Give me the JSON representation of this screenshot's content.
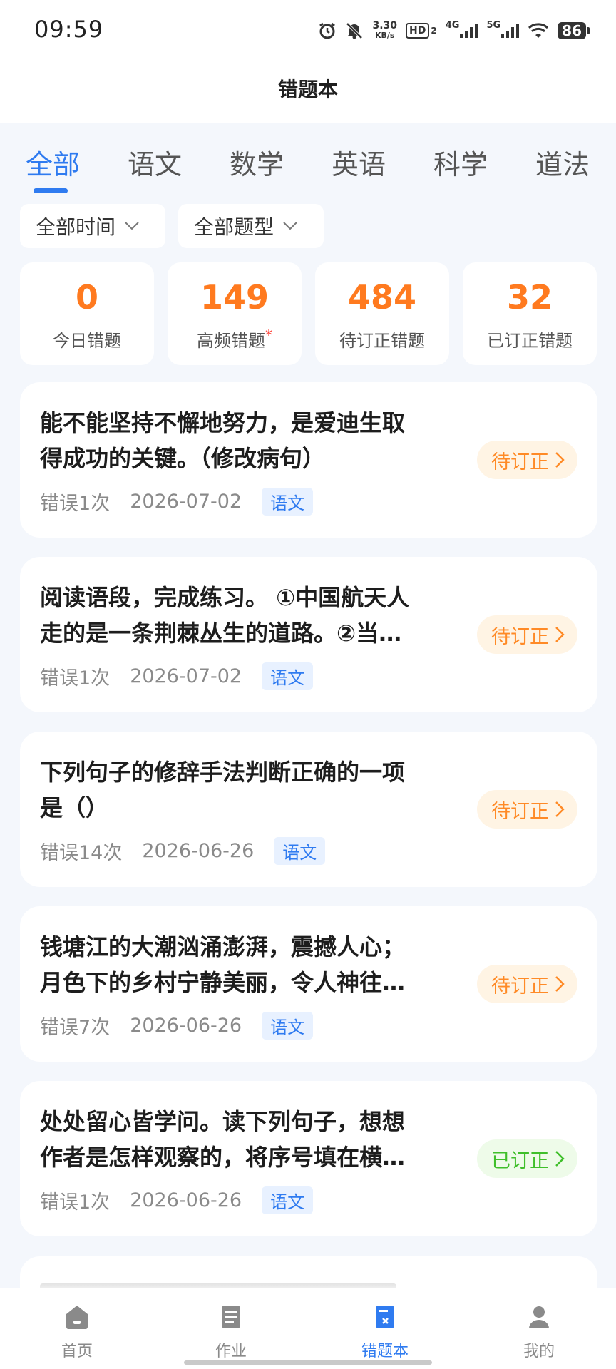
{
  "statusbar": {
    "time": "09:59",
    "speed_top": "3.30",
    "speed_bottom": "KB/s",
    "hd": "HD",
    "hd_sub": "2",
    "net1": "4G",
    "net2": "5G",
    "battery": "86",
    "icons": [
      "alarm-icon",
      "mute-icon",
      "signal-icon",
      "wifi-icon",
      "battery-icon"
    ]
  },
  "header": {
    "title": "错题本"
  },
  "tabs": [
    {
      "label": "全部",
      "active": true
    },
    {
      "label": "语文",
      "active": false
    },
    {
      "label": "数学",
      "active": false
    },
    {
      "label": "英语",
      "active": false
    },
    {
      "label": "科学",
      "active": false
    },
    {
      "label": "道法",
      "active": false
    }
  ],
  "filters": [
    {
      "label": "全部时间"
    },
    {
      "label": "全部题型"
    }
  ],
  "stats": [
    {
      "value": "0",
      "label": "今日错题"
    },
    {
      "value": "149",
      "label": "高频错题",
      "marker": "*"
    },
    {
      "value": "484",
      "label": "待订正错题"
    },
    {
      "value": "32",
      "label": "已订正错题"
    }
  ],
  "colors": {
    "accent": "#2f7bf0",
    "stat_number": "#ff7a1f",
    "pending": "#ff8a26",
    "done": "#3fbf2a"
  },
  "items": [
    {
      "line1": "能不能坚持不懈地努力，是爱迪生取",
      "line2": "得成功的关键。（修改病句）",
      "errors": "错误1次",
      "date": "2026-07-02",
      "subject": "语文",
      "status": "待订正",
      "state": "pending"
    },
    {
      "line1": "阅读语段，完成练习。 ①中国航天人",
      "line2": "走的是一条荆棘丛生的道路。②当…",
      "errors": "错误1次",
      "date": "2026-07-02",
      "subject": "语文",
      "status": "待订正",
      "state": "pending"
    },
    {
      "line1": "下列句子的修辞手法判断正确的一项",
      "line2": "是（）",
      "errors": "错误14次",
      "date": "2026-06-26",
      "subject": "语文",
      "status": "待订正",
      "state": "pending"
    },
    {
      "line1": "钱塘江的大潮汹涌澎湃，震撼人心；",
      "line2": "月色下的乡村宁静美丽，令人神往…",
      "errors": "错误7次",
      "date": "2026-06-26",
      "subject": "语文",
      "status": "待订正",
      "state": "pending"
    },
    {
      "line1": "处处留心皆学问。读下列句子，想想",
      "line2": "作者是怎样观察的，将序号填在横…",
      "errors": "错误1次",
      "date": "2026-06-26",
      "subject": "语文",
      "status": "已订正",
      "state": "done"
    }
  ],
  "bottom_nav": [
    {
      "label": "首页",
      "icon": "home-icon",
      "active": false
    },
    {
      "label": "作业",
      "icon": "homework-icon",
      "active": false
    },
    {
      "label": "错题本",
      "icon": "mistakes-icon",
      "active": true
    },
    {
      "label": "我的",
      "icon": "profile-icon",
      "active": false
    }
  ]
}
